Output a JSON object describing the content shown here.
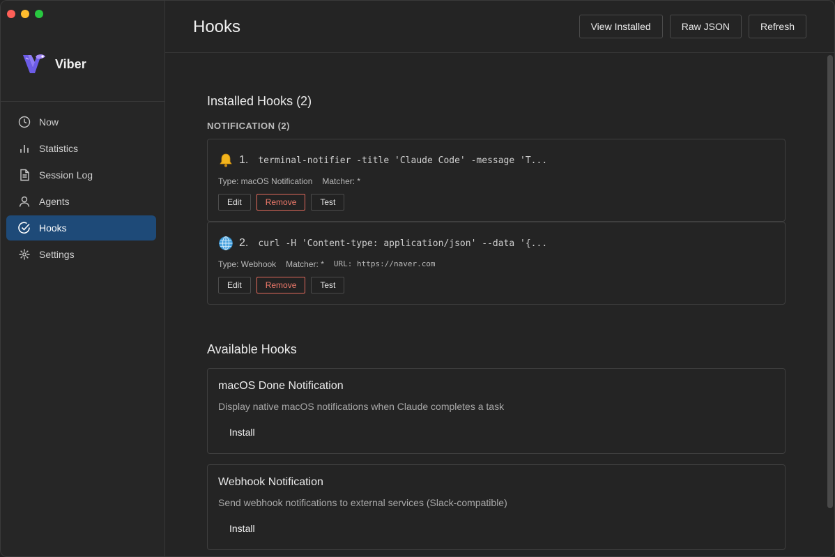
{
  "app": {
    "name": "Viber"
  },
  "sidebar": {
    "items": [
      {
        "label": "Now",
        "icon": "clock-icon",
        "active": false
      },
      {
        "label": "Statistics",
        "icon": "bar-chart-icon",
        "active": false
      },
      {
        "label": "Session Log",
        "icon": "document-icon",
        "active": false
      },
      {
        "label": "Agents",
        "icon": "person-icon",
        "active": false
      },
      {
        "label": "Hooks",
        "icon": "check-circle-icon",
        "active": true
      },
      {
        "label": "Settings",
        "icon": "settings-icon",
        "active": false
      }
    ]
  },
  "header": {
    "title": "Hooks",
    "buttons": {
      "view_installed": "View Installed",
      "raw_json": "Raw JSON",
      "refresh": "Refresh"
    }
  },
  "installed": {
    "title": "Installed Hooks (2)",
    "group_label": "NOTIFICATION (2)",
    "hooks": [
      {
        "icon": "bell-icon",
        "number": "1.",
        "command": "terminal-notifier -title 'Claude Code' -message 'T...",
        "type": "Type: macOS Notification",
        "matcher": "Matcher: *",
        "url": ""
      },
      {
        "icon": "globe-icon",
        "number": "2.",
        "command": "curl -H 'Content-type: application/json' --data '{...",
        "type": "Type: Webhook",
        "matcher": "Matcher: *",
        "url": "URL: https://naver.com"
      }
    ],
    "actions": {
      "edit": "Edit",
      "remove": "Remove",
      "test": "Test"
    }
  },
  "available": {
    "title": "Available Hooks",
    "hooks": [
      {
        "name": "macOS Done Notification",
        "description": "Display native macOS notifications when Claude completes a task",
        "install_label": "Install"
      },
      {
        "name": "Webhook Notification",
        "description": "Send webhook notifications to external services (Slack-compatible)",
        "install_label": "Install"
      }
    ]
  },
  "colors": {
    "accent_active": "#1e4a78",
    "danger": "#f07a6b",
    "background": "#242424"
  }
}
